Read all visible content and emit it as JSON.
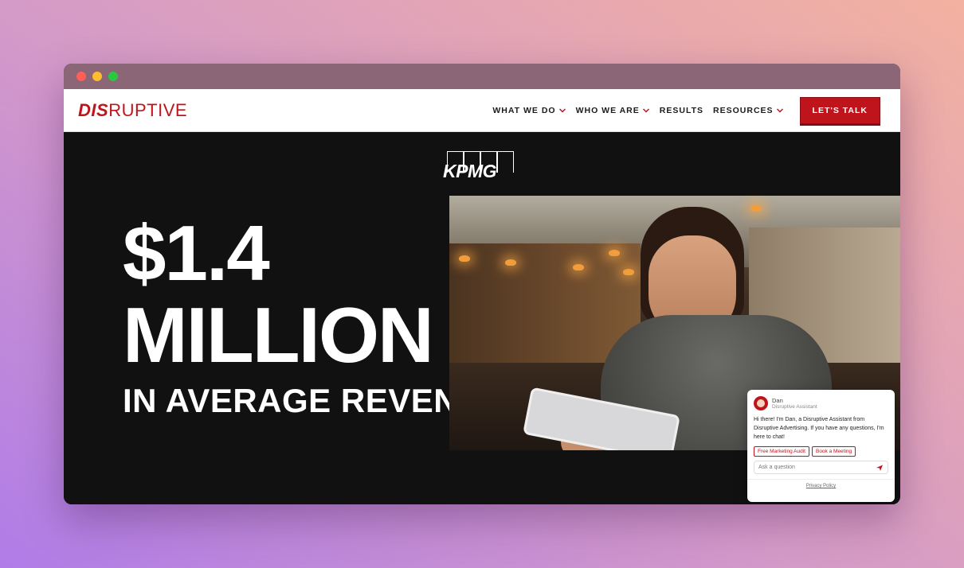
{
  "nav": {
    "logo": {
      "part1": "DIS",
      "part2": "RUPTIVE"
    },
    "items": [
      {
        "label": "WHAT WE DO",
        "has_dropdown": true
      },
      {
        "label": "WHO WE ARE",
        "has_dropdown": true
      },
      {
        "label": "RESULTS",
        "has_dropdown": false
      },
      {
        "label": "RESOURCES",
        "has_dropdown": true
      }
    ],
    "cta": "LET'S TALK"
  },
  "hero": {
    "client_logo": "KPMG",
    "line1": "$1.4",
    "line2": "MILLION",
    "line3": "IN AVERAGE REVENUE"
  },
  "chat": {
    "name": "Dan",
    "role": "Disruptive Assistant",
    "message": "Hi there! I'm Dan, a Disruptive Assistant from Disruptive Advertising. If you have any questions, I'm here to chat!",
    "actions": [
      "Free Marketing Audit",
      "Book a Meeting"
    ],
    "input_placeholder": "Ask a question",
    "footer": "Privacy Policy"
  },
  "colors": {
    "brand_red": "#c0141c",
    "hero_bg": "#111111"
  }
}
